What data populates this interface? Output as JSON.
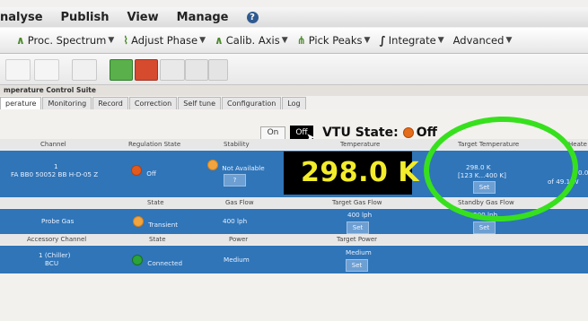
{
  "menu": {
    "items": [
      "nalyse",
      "Publish",
      "View",
      "Manage"
    ],
    "help": "?"
  },
  "toolbar": {
    "proc_spectrum": "Proc. Spectrum",
    "adjust_phase": "Adjust Phase",
    "calib_axis": "Calib. Axis",
    "pick_peaks": "Pick Peaks",
    "integrate": "Integrate",
    "advanced": "Advanced"
  },
  "suite": {
    "title": "mperature Control Suite"
  },
  "tabs": [
    "perature",
    "Monitoring",
    "Record",
    "Correction",
    "Self tune",
    "Configuration",
    "Log"
  ],
  "vtu": {
    "on_label": "On",
    "off_label": "Off",
    "state_label": "VTU State:",
    "state_value": "Off"
  },
  "table1": {
    "headers": [
      "Channel",
      "Regulation State",
      "Stability",
      "Temperature",
      "Target Temperature",
      "Heate"
    ],
    "channel_line1": "1",
    "channel_line2": "FA BB0 50052 BB H-D-05 Z",
    "regulation": "Off",
    "stability": "Not Available",
    "stability_btn": "?",
    "temperature": "298.0 K",
    "target_value": "298.0 K",
    "target_range": "[123 K...400 K]",
    "target_btn": "Set",
    "heater_top": "0.0",
    "heater_bottom": "of 49.1 W"
  },
  "table2": {
    "headers": [
      "State",
      "Gas Flow",
      "Target Gas Flow",
      "Standby Gas Flow"
    ],
    "name": "Probe Gas",
    "state": "Transient",
    "gas_flow": "400 lph",
    "target_gas_flow": "400 lph",
    "target_btn": "Set",
    "standby_value": "200 lph",
    "standby_btn": "Set"
  },
  "table3": {
    "headers": [
      "Accessory Channel",
      "State",
      "Power",
      "Target Power"
    ],
    "name_line1": "1 (Chiller)",
    "name_line2": "BCU",
    "state": "Connected",
    "power": "Medium",
    "target_power": "Medium",
    "target_btn": "Set"
  }
}
